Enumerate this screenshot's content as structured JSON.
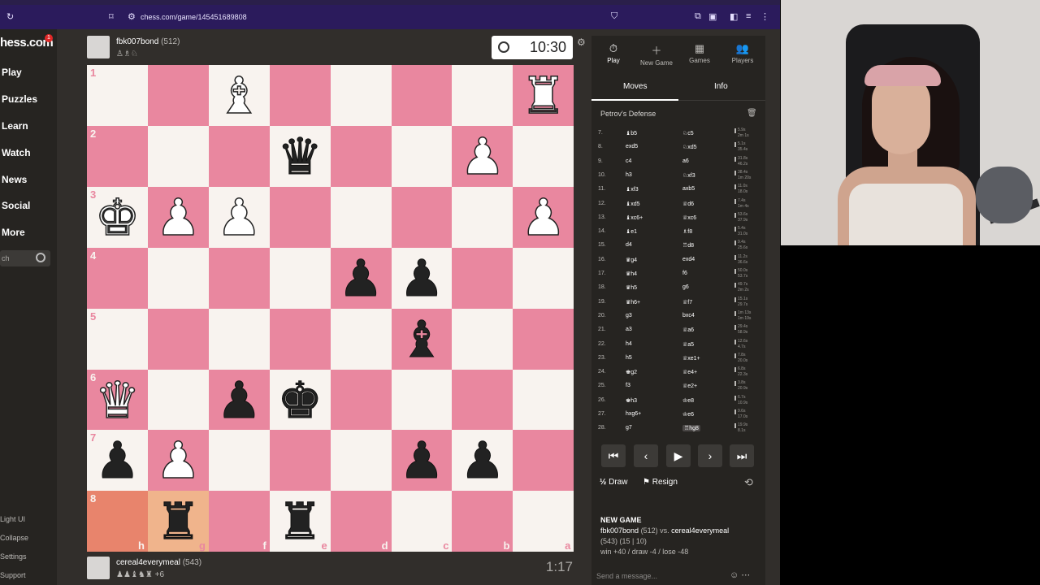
{
  "browser": {
    "url": "chess.com/game/145451689808",
    "brand_color": "#2b1b5c"
  },
  "site": {
    "logo": "hess.com",
    "logo_badge": "1",
    "nav": [
      "Play",
      "Puzzles",
      "Learn",
      "Watch",
      "News",
      "Social",
      "More"
    ],
    "search_placeholder": "ch",
    "footer": [
      "Light UI",
      "Collapse",
      "Settings",
      "Support"
    ]
  },
  "top_player": {
    "name": "fbk007bond",
    "rating": "(512)",
    "clock": "10:30",
    "captured_icons": "♙♗♘"
  },
  "bottom_player": {
    "name": "cereal4everymeal",
    "rating": "(543)",
    "clock": "1:17",
    "captured_icons": "♟♟♝♞♜",
    "advantage": "+6"
  },
  "board": {
    "light_color": "#f8f3ef",
    "dark_color": "#e9879f",
    "highlight_color": "#e8846c",
    "rank_labels": [
      "1",
      "2",
      "3",
      "4",
      "5",
      "6",
      "7",
      "8"
    ],
    "file_labels": [
      "h",
      "g",
      "f",
      "e",
      "d",
      "c",
      "b",
      "a"
    ],
    "pieces": [
      {
        "square": "f1",
        "glyph": "♝",
        "color": "w"
      },
      {
        "square": "a1",
        "glyph": "♜",
        "color": "w"
      },
      {
        "square": "e2",
        "glyph": "♛",
        "color": "b"
      },
      {
        "square": "b2",
        "glyph": "♟",
        "color": "w"
      },
      {
        "square": "h3",
        "glyph": "♚",
        "color": "w"
      },
      {
        "square": "g3",
        "glyph": "♟",
        "color": "w"
      },
      {
        "square": "f3",
        "glyph": "♟",
        "color": "w"
      },
      {
        "square": "a3",
        "glyph": "♟",
        "color": "w"
      },
      {
        "square": "d4",
        "glyph": "♟",
        "color": "b"
      },
      {
        "square": "c4",
        "glyph": "♟",
        "color": "b"
      },
      {
        "square": "c5",
        "glyph": "♝",
        "color": "b"
      },
      {
        "square": "h6",
        "glyph": "♛",
        "color": "w"
      },
      {
        "square": "f6",
        "glyph": "♟",
        "color": "b"
      },
      {
        "square": "e6",
        "glyph": "♚",
        "color": "b"
      },
      {
        "square": "h7",
        "glyph": "♟",
        "color": "b"
      },
      {
        "square": "g7",
        "glyph": "♟",
        "color": "w"
      },
      {
        "square": "c7",
        "glyph": "♟",
        "color": "b"
      },
      {
        "square": "b7",
        "glyph": "♟",
        "color": "b"
      },
      {
        "square": "g8",
        "glyph": "♜",
        "color": "b"
      },
      {
        "square": "e8",
        "glyph": "♜",
        "color": "b"
      }
    ],
    "highlights": [
      "h8",
      "g8"
    ]
  },
  "panel": {
    "tabs": [
      {
        "label": "Play",
        "icon": "⏱"
      },
      {
        "label": "New Game",
        "icon": "＋"
      },
      {
        "label": "Games",
        "icon": "▦"
      },
      {
        "label": "Players",
        "icon": "👥"
      }
    ],
    "subtabs": [
      "Moves",
      "Info"
    ],
    "opening": "Petrov's Defense",
    "moves": [
      {
        "n": "7.",
        "w": "♝b5",
        "b": "♘c5",
        "t1": "5.9s",
        "t2": "2m 1s"
      },
      {
        "n": "8.",
        "w": "exd5",
        "b": "♘xd5",
        "t1": "5.1s",
        "t2": "35.4s"
      },
      {
        "n": "9.",
        "w": "c4",
        "b": "a6",
        "t1": "31.8s",
        "t2": "46.2s"
      },
      {
        "n": "10.",
        "w": "h3",
        "b": "♘xf3",
        "t1": "38.4s",
        "t2": "1m 20s"
      },
      {
        "n": "11.",
        "w": "♝xf3",
        "b": "axb5",
        "t1": "11.0s",
        "t2": "18.0s"
      },
      {
        "n": "12.",
        "w": "♝xd5",
        "b": "♕d6",
        "t1": "7.4s",
        "t2": "1m 4s"
      },
      {
        "n": "13.",
        "w": "♝xc6+",
        "b": "♕xc6",
        "t1": "53.6s",
        "t2": "37.9s"
      },
      {
        "n": "14.",
        "w": "♝e1",
        "b": "♗f8",
        "t1": "5.4s",
        "t2": "31.0s"
      },
      {
        "n": "15.",
        "w": "d4",
        "b": "♖d8",
        "t1": "9.4s",
        "t2": "25.6s"
      },
      {
        "n": "16.",
        "w": "♛g4",
        "b": "exd4",
        "t1": "11.2s",
        "t2": "36.6s"
      },
      {
        "n": "17.",
        "w": "♛h4",
        "b": "f6",
        "t1": "50.0s",
        "t2": "53.7s"
      },
      {
        "n": "18.",
        "w": "♛h5",
        "b": "g6",
        "t1": "49.7s",
        "t2": "2m 2s"
      },
      {
        "n": "19.",
        "w": "♛h6+",
        "b": "♕f7",
        "t1": "15.1s",
        "t2": "29.7s"
      },
      {
        "n": "20.",
        "w": "g3",
        "b": "bxc4",
        "t1": "1m 13s",
        "t2": "1m 19s"
      },
      {
        "n": "21.",
        "w": "a3",
        "b": "♕a6",
        "t1": "29.4s",
        "t2": "58.9s"
      },
      {
        "n": "22.",
        "w": "h4",
        "b": "♕a5",
        "t1": "12.6s",
        "t2": "4.7s"
      },
      {
        "n": "23.",
        "w": "h5",
        "b": "♕xe1+",
        "t1": "7.8s",
        "t2": "20.0s"
      },
      {
        "n": "24.",
        "w": "♚g2",
        "b": "♕e4+",
        "t1": "6.8s",
        "t2": "22.3s"
      },
      {
        "n": "25.",
        "w": "f3",
        "b": "♕e2+",
        "t1": "3.8s",
        "t2": "20.9s"
      },
      {
        "n": "26.",
        "w": "♚h3",
        "b": "♔e8",
        "t1": "6.7s",
        "t2": "10.9s"
      },
      {
        "n": "27.",
        "w": "hxg6+",
        "b": "♔e6",
        "t1": "9.6s",
        "t2": "17.0s"
      },
      {
        "n": "28.",
        "w": "g7",
        "b": "♖hg8",
        "t1": "19.9s",
        "t2": "8.1s"
      }
    ],
    "nav_buttons": [
      "⏮",
      "‹",
      "▶",
      "›",
      "⏭"
    ],
    "draw_label": "Draw",
    "draw_icon": "½",
    "resign_label": "Resign",
    "new_game": {
      "title": "NEW GAME",
      "white": "fbk007bond",
      "white_rating": "(512)",
      "vs": "vs.",
      "black": "cereal4everymeal",
      "black_rating": "(543) (15 | 10)",
      "result": "win +40 / draw -4 / lose -48"
    },
    "message_placeholder": "Send a message..."
  }
}
